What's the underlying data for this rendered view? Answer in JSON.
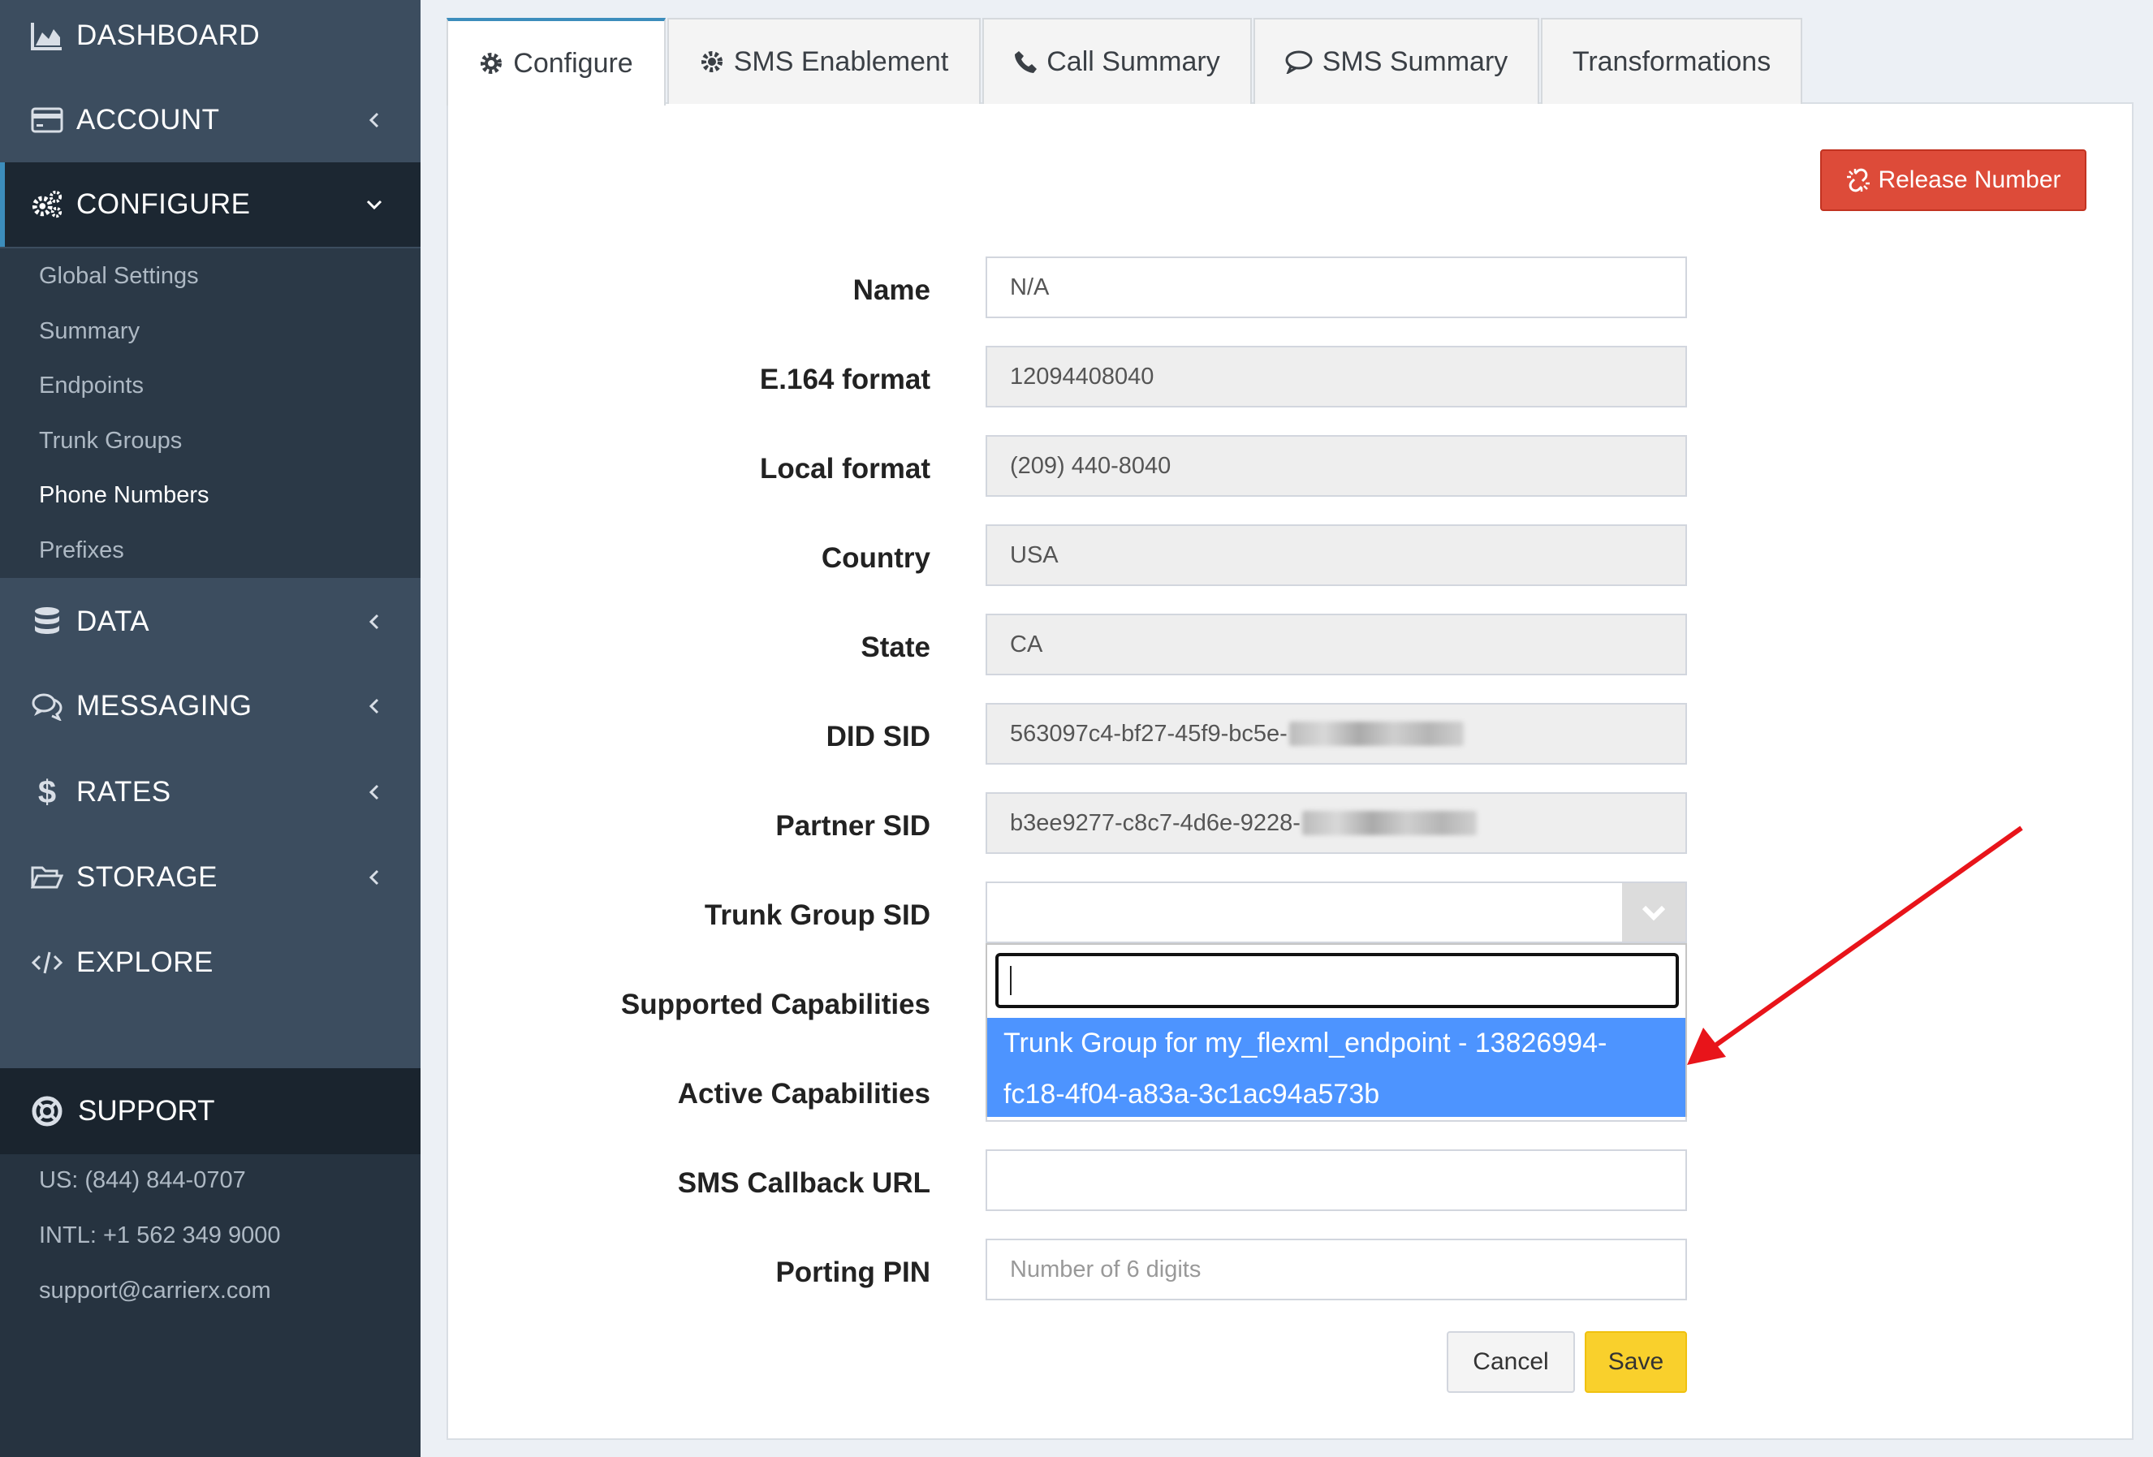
{
  "sidebar": {
    "items": [
      {
        "label": "DASHBOARD",
        "icon": "area-chart-icon"
      },
      {
        "label": "ACCOUNT",
        "icon": "credit-card-icon"
      },
      {
        "label": "CONFIGURE",
        "icon": "gears-icon"
      },
      {
        "label": "DATA",
        "icon": "database-icon"
      },
      {
        "label": "MESSAGING",
        "icon": "comments-icon"
      },
      {
        "label": "RATES",
        "icon": "dollar-icon"
      },
      {
        "label": "STORAGE",
        "icon": "folder-open-icon"
      },
      {
        "label": "EXPLORE",
        "icon": "code-icon"
      }
    ],
    "configure_sub": [
      "Global Settings",
      "Summary",
      "Endpoints",
      "Trunk Groups",
      "Phone Numbers",
      "Prefixes"
    ],
    "active_sub": "Phone Numbers",
    "support": {
      "label": "SUPPORT",
      "us": "US: (844) 844-0707",
      "intl": "INTL: +1 562 349 9000",
      "email": "support@carrierx.com"
    }
  },
  "tabs": [
    {
      "label": "Configure",
      "icon": "gear-icon",
      "active": true
    },
    {
      "label": "SMS Enablement",
      "icon": "gear-icon",
      "active": false
    },
    {
      "label": "Call Summary",
      "icon": "phone-icon",
      "active": false
    },
    {
      "label": "SMS Summary",
      "icon": "comment-icon",
      "active": false
    },
    {
      "label": "Transformations",
      "icon": "",
      "active": false
    }
  ],
  "release_button": "Release Number",
  "form": {
    "name": {
      "label": "Name",
      "value": "N/A"
    },
    "e164": {
      "label": "E.164 format",
      "value": "12094408040"
    },
    "local": {
      "label": "Local format",
      "value": "(209) 440-8040"
    },
    "country": {
      "label": "Country",
      "value": "USA"
    },
    "state": {
      "label": "State",
      "value": "CA"
    },
    "did_sid": {
      "label": "DID SID",
      "value": "563097c4-bf27-45f9-bc5e-"
    },
    "partner_sid": {
      "label": "Partner SID",
      "value": "b3ee9277-c8c7-4d6e-9228-"
    },
    "trunk_group_sid": {
      "label": "Trunk Group SID",
      "value": ""
    },
    "supported_caps": {
      "label": "Supported Capabilities"
    },
    "active_caps": {
      "label": "Active Capabilities"
    },
    "sms_callback": {
      "label": "SMS Callback URL",
      "value": ""
    },
    "porting_pin": {
      "label": "Porting PIN",
      "placeholder": "Number of 6 digits"
    }
  },
  "dropdown": {
    "search_value": "",
    "option_line1": "Trunk Group for my_flexml_endpoint - 13826994-",
    "option_line2": "fc18-4f04-a83a-3c1ac94a573b"
  },
  "buttons": {
    "cancel": "Cancel",
    "save": "Save"
  },
  "colors": {
    "sidebar_bg": "#3c4d5f",
    "sidebar_active": "#1c2732",
    "danger": "#dd4b39",
    "highlight": "#4d94ff",
    "save": "#f9d02c",
    "annotation_arrow": "#e8141a"
  }
}
